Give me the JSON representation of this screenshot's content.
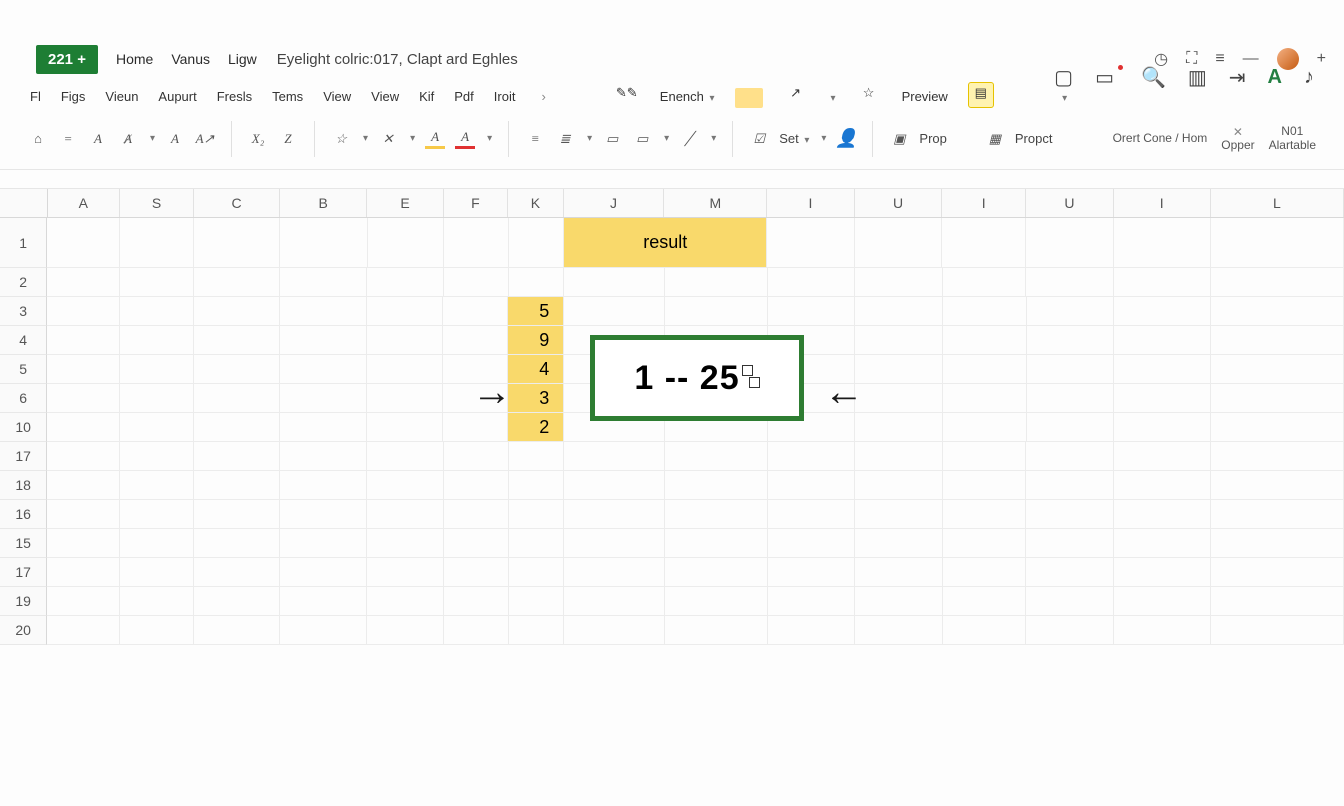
{
  "titlebar": {
    "badge": "221 +",
    "menu": [
      "Home",
      "Vanus",
      "Ligw"
    ],
    "doc_title": "Eyelight colric:017, Clapt ard Eghles"
  },
  "wincontrols": {
    "clock": "◷",
    "full": "⛶",
    "menu": "≡",
    "min": "—",
    "plus": "+"
  },
  "tabs": [
    "Fl",
    "Figs",
    "Vieun",
    "Aupurt",
    "Fresls",
    "Tems",
    "View",
    "View",
    "Kif",
    "Pdf",
    "Iroit"
  ],
  "tools": {
    "home": "⌂",
    "eq": "=",
    "italic": "A",
    "double_a": "Ⱥ",
    "a_caret": "A",
    "ax": "A↗",
    "x2": "X₂",
    "z": "Z",
    "star": "☆",
    "x": "✕",
    "a_hl": "A",
    "a_color": "A",
    "align1": "≡",
    "align2": "≣",
    "paste": "▭",
    "copy": "▭",
    "line": "╱",
    "edit": "✎✎",
    "font_dd": "Enench",
    "expand": "↗",
    "fav": "☆",
    "preview": "Preview",
    "doc": "▤",
    "check": "☑",
    "set_dd": "Set",
    "person": "👤",
    "prop_ic": "▣",
    "prop": "Prop",
    "propct_ic": "▦",
    "propct": "Propct"
  },
  "ribbon_right": {
    "orert": "Orert Cone / Hom",
    "opper": "Opper",
    "close": "✕",
    "n01": "N01",
    "alat": "Alartable",
    "a_big": "A",
    "note": "♪"
  },
  "columns": [
    "A",
    "S",
    "C",
    "B",
    "E",
    "F",
    "K",
    "J",
    "M",
    "I",
    "U",
    "I",
    "U",
    "I",
    "L"
  ],
  "row_labels": [
    "1",
    "2",
    "3",
    "4",
    "5",
    "6",
    "10",
    "17",
    "18",
    "16",
    "15",
    "17",
    "19",
    "20"
  ],
  "header_cell": "result",
  "k_vals": [
    "5",
    "9",
    "4",
    "3",
    "2"
  ],
  "big_result": "1 -- 25",
  "arrows": {
    "right": "→",
    "left": "←"
  }
}
